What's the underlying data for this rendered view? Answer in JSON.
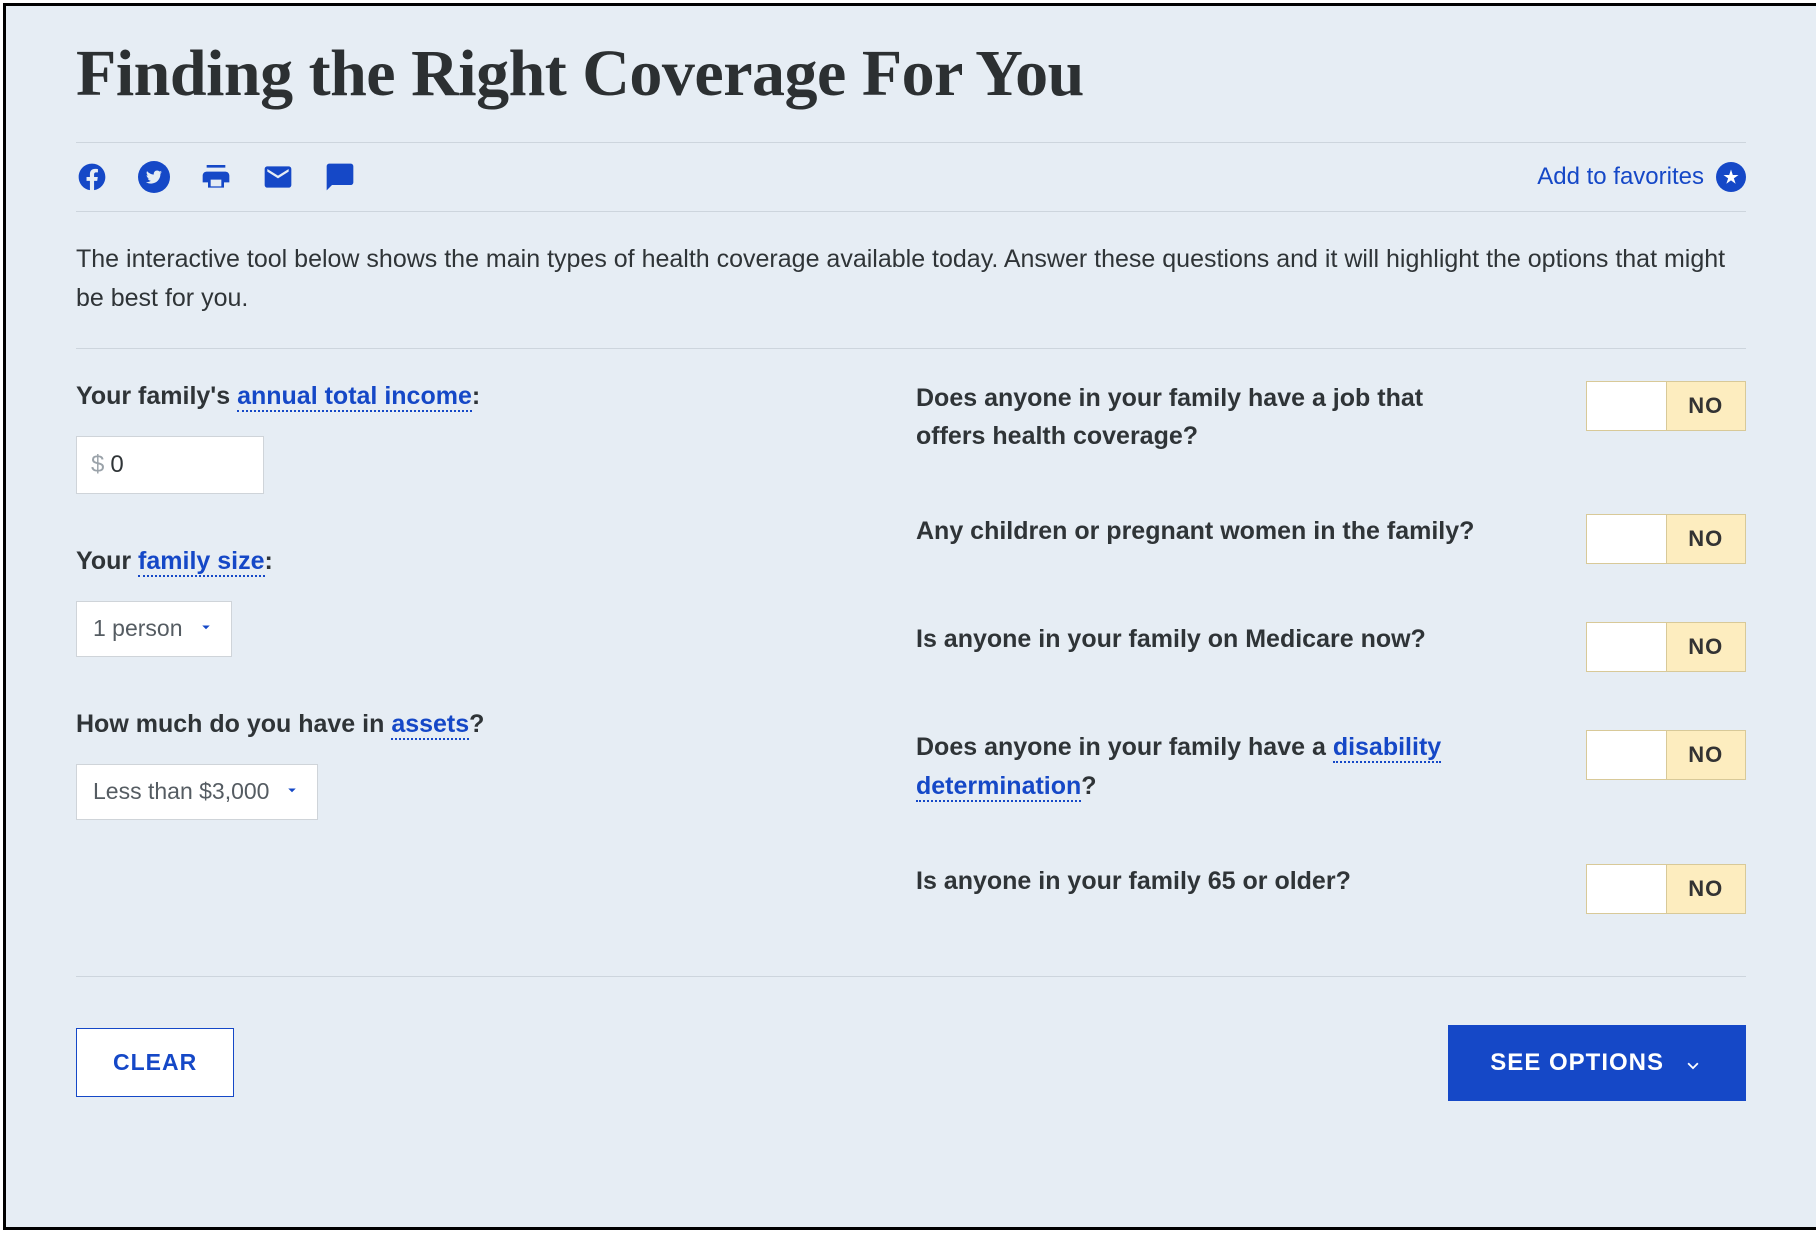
{
  "header": {
    "title": "Finding the Right Coverage For You",
    "add_favorites": "Add to favorites"
  },
  "intro": "The interactive tool below shows the main types of health coverage available today. Answer these questions and it will highlight the options that might be best for you.",
  "left": {
    "income_label_pre": "Your family's ",
    "income_term": "annual total income",
    "income_label_post": ":",
    "income_prefix": "$",
    "income_value": "0",
    "family_label_pre": "Your ",
    "family_term": "family size",
    "family_label_post": ":",
    "family_value": "1 person",
    "assets_label_pre": "How much do you have in ",
    "assets_term": "assets",
    "assets_label_post": "?",
    "assets_value": "Less than $3,000"
  },
  "questions": {
    "q1": "Does anyone in your family have a job that offers health coverage?",
    "q2": "Any children or pregnant women in the family?",
    "q3": "Is anyone in your family on Medicare now?",
    "q4_pre": "Does anyone in your family have a ",
    "q4_term": "disability determination",
    "q4_post": "?",
    "q5": "Is anyone in your family 65 or older?",
    "no_label": "NO"
  },
  "buttons": {
    "clear": "CLEAR",
    "see_options": "SEE OPTIONS"
  }
}
